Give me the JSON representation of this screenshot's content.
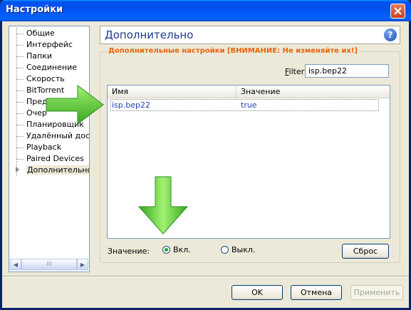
{
  "window": {
    "title": "Настройки"
  },
  "sidebar": {
    "items": [
      {
        "label": "Общие"
      },
      {
        "label": "Интерфейс"
      },
      {
        "label": "Папки"
      },
      {
        "label": "Соединение"
      },
      {
        "label": "Скорость"
      },
      {
        "label": "BitTorrent"
      },
      {
        "label": "Пред"
      },
      {
        "label": "Очер"
      },
      {
        "label": "Планировщик"
      },
      {
        "label": "Удалённый дост"
      },
      {
        "label": "Playback"
      },
      {
        "label": "Paired Devices"
      },
      {
        "label": "Дополнительно"
      }
    ],
    "scrollbar": {
      "thumb_glyph": "III"
    }
  },
  "main": {
    "title": "Дополнительно",
    "group_title": "Дополнительные настройки [ВНИМАНИЕ: Не изменяйте их!]",
    "filter": {
      "label_prefix": "F",
      "label_rest": "ilter:",
      "value": "isp.bep22"
    },
    "table": {
      "columns": [
        "Имя",
        "Значение"
      ],
      "rows": [
        {
          "name": "isp.bep22",
          "value": "true"
        }
      ]
    },
    "value_label": "Значение:",
    "radio_on": {
      "label": "Вкл.",
      "checked": true
    },
    "radio_off": {
      "label": "Выкл.",
      "checked": false
    },
    "reset_label": "Сброс"
  },
  "footer": {
    "ok": "OK",
    "cancel": "Отмена",
    "apply": "Применить"
  },
  "colors": {
    "accent_orange": "#e8630a",
    "title_blue": "#1f3c8c",
    "arrow_green": "#3cc21b"
  },
  "icons": {
    "help": "help-icon",
    "close": "close-icon",
    "overlay_arrows": "green-arrow-icon"
  }
}
